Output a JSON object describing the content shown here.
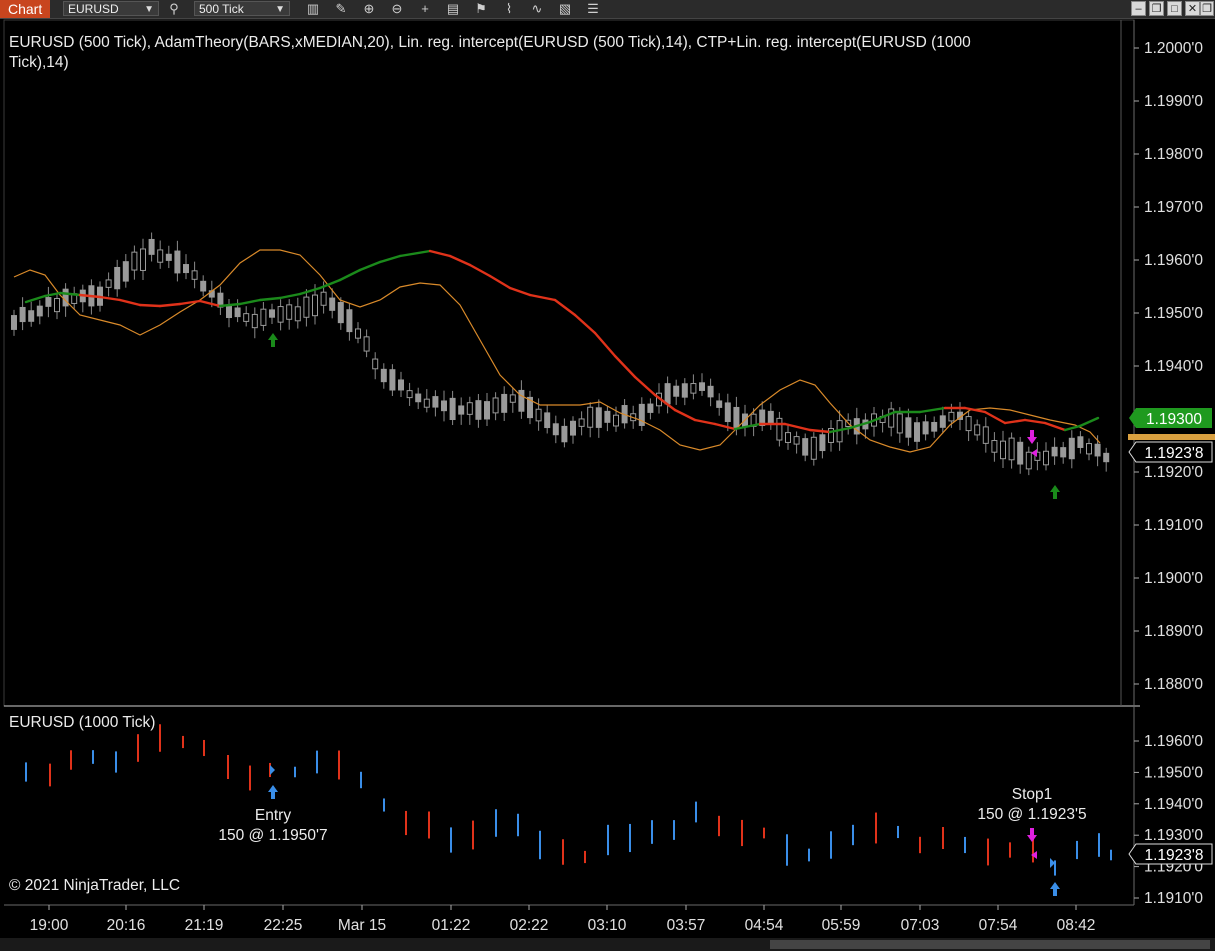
{
  "toolbar": {
    "tab_label": "Chart",
    "instrument": "EURUSD",
    "interval": "500 Tick"
  },
  "colors": {
    "background": "#000000",
    "up_green": "#1b8a1b",
    "down_red": "#e0321a",
    "orange_line": "#d98a2a",
    "buy_arrow": "#1a8a1a",
    "fill_blue": "#3a8ee8",
    "sell_magenta": "#e020e0",
    "price_green_badge": "#1f9a1f",
    "last_price_orange": "#d9a040"
  },
  "main_panel": {
    "title": "EURUSD (500 Tick), AdamTheory(BARS,xMEDIAN,20), Lin. reg. intercept(EURUSD (500 Tick),14), CTP+Lin. reg. intercept(EURUSD (1000 Tick),14)",
    "axis_labels": [
      "1.2000'0",
      "1.1990'0",
      "1.1980'0",
      "1.1970'0",
      "1.1960'0",
      "1.1950'0",
      "1.1940'0",
      "1.1930'0",
      "1.1920'0",
      "1.1910'0",
      "1.1900'0",
      "1.1890'0",
      "1.1880'0"
    ],
    "price_badge_green": "1.19300",
    "price_badge_last": "1.1923'8"
  },
  "sub_panel": {
    "title": "EURUSD (1000 Tick)",
    "axis_labels": [
      "1.1960'0",
      "1.1950'0",
      "1.1940'0",
      "1.1930'0",
      "1.1920'0",
      "1.1910'0"
    ],
    "price_badge_last": "1.1923'8",
    "entry_label": "Entry",
    "entry_detail": "150 @ 1.1950'7",
    "stop_label": "Stop1",
    "stop_detail": "150 @ 1.1923'5",
    "copyright": "© 2021 NinjaTrader, LLC"
  },
  "time_axis": [
    "19:00",
    "20:16",
    "21:19",
    "22:25",
    "Mar 15",
    "01:22",
    "02:22",
    "03:10",
    "03:57",
    "04:54",
    "05:59",
    "07:03",
    "07:54",
    "08:42"
  ]
}
